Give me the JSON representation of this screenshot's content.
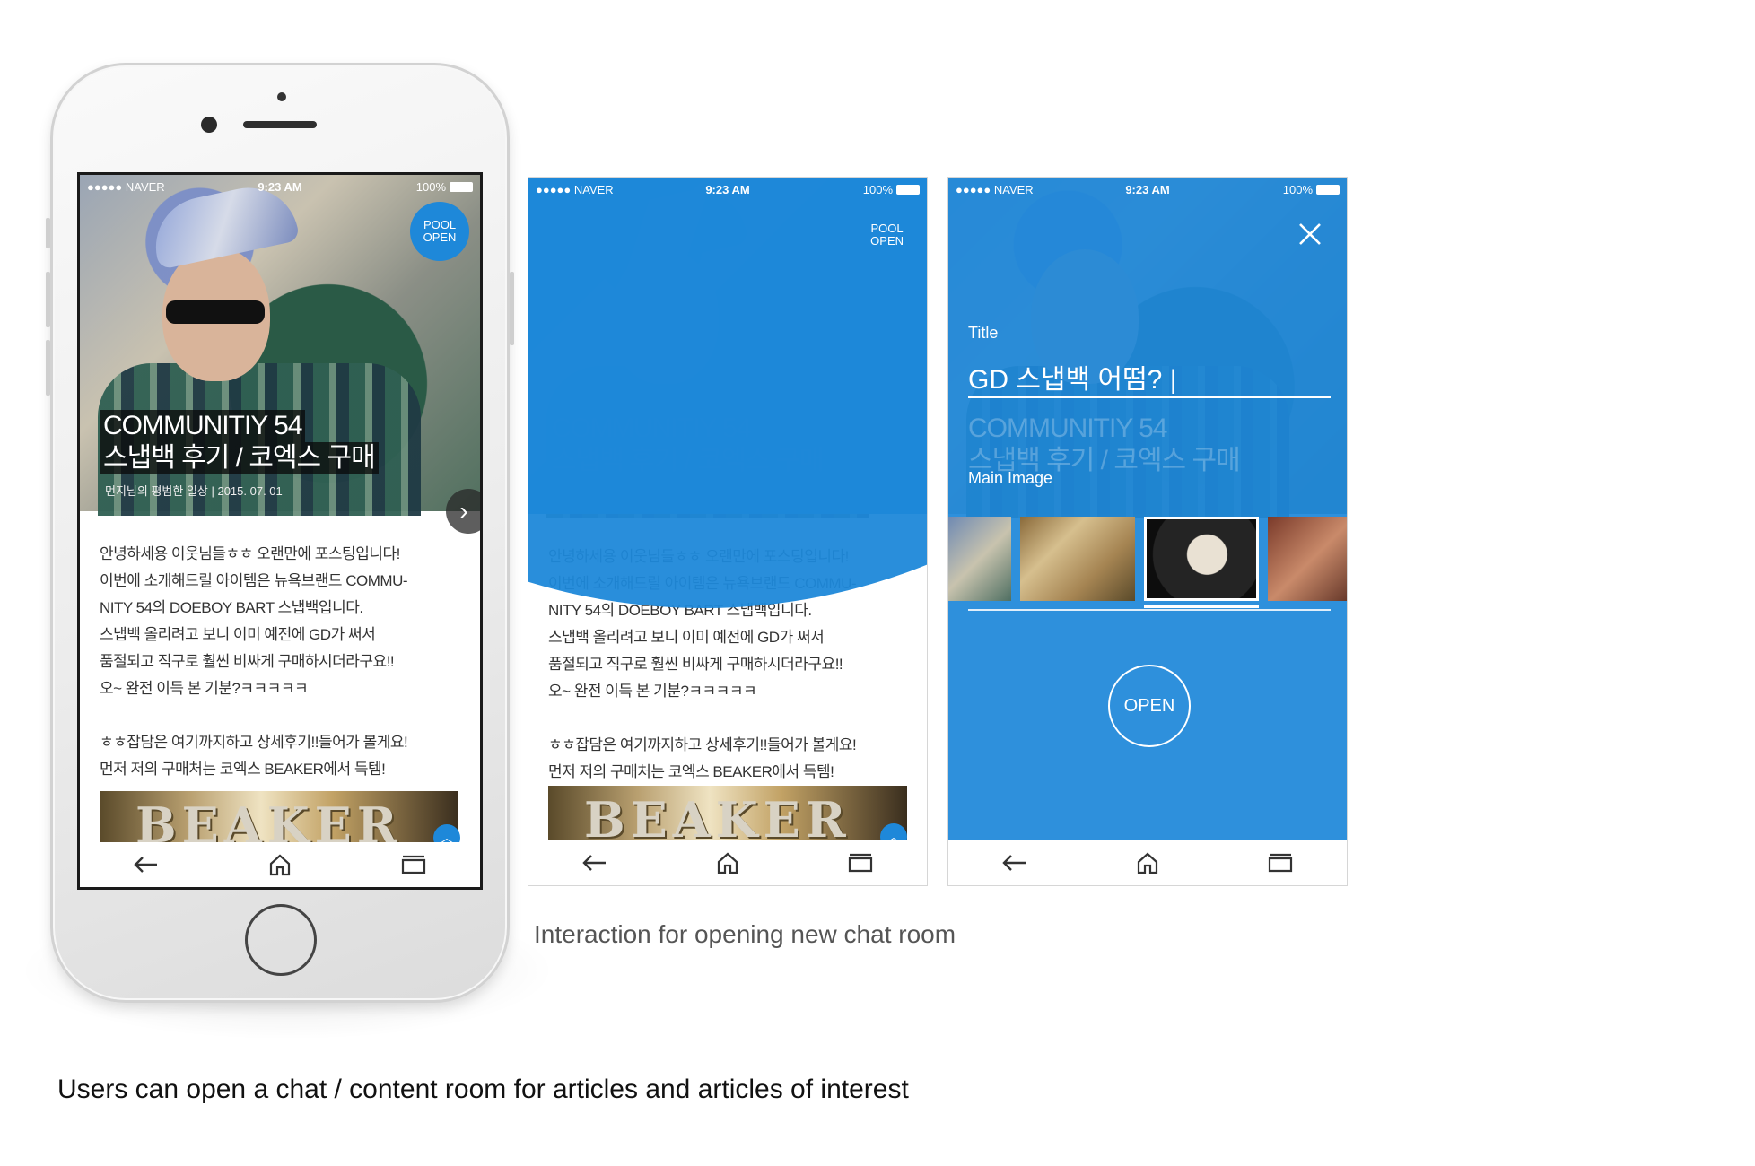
{
  "status": {
    "carrier": "●●●●● NAVER",
    "time": "9:23 AM",
    "battery": "100%"
  },
  "badge": {
    "line1": "POOL",
    "line2": "OPEN"
  },
  "article": {
    "title1": "COMMUNITIY 54",
    "title2": "스냅백 후기 / 코엑스 구매",
    "meta": "먼지님의 평범한 일상 | 2015. 07. 01",
    "para1": [
      "안녕하세용 이웃님들ㅎㅎ 오랜만에 포스팅입니다!",
      "이번에 소개해드릴 아이템은 뉴욕브랜드 COMMU-",
      "NITY 54의 DOEBOY BART 스냅백입니다.",
      "스냅백 올리려고 보니 이미 예전에 GD가 써서",
      "품절되고 직구로 훨씬 비싸게 구매하시더라구요!!",
      "오~ 완전 이득 본 기분?ㅋㅋㅋㅋㅋ"
    ],
    "para2": [
      "ㅎㅎ잡담은 여기까지하고 상세후기!!들어가 볼게요!",
      "먼저 저의 구매처는 코엑스 BEAKER에서 득템!"
    ],
    "image_text": "BEAKER"
  },
  "form": {
    "title_label": "Title",
    "title_value": "GD 스냅백 어떰? |",
    "main_image_label": "Main Image",
    "open_label": "OPEN"
  },
  "icons": {
    "back": "back-arrow-icon",
    "home": "home-icon",
    "tabs": "tabs-icon",
    "close": "close-icon"
  },
  "colors": {
    "accent": "#1e88d9"
  },
  "captions": {
    "interaction": "Interaction for opening new chat room",
    "summary": "Users can open a chat / content room for articles and articles of interest"
  }
}
